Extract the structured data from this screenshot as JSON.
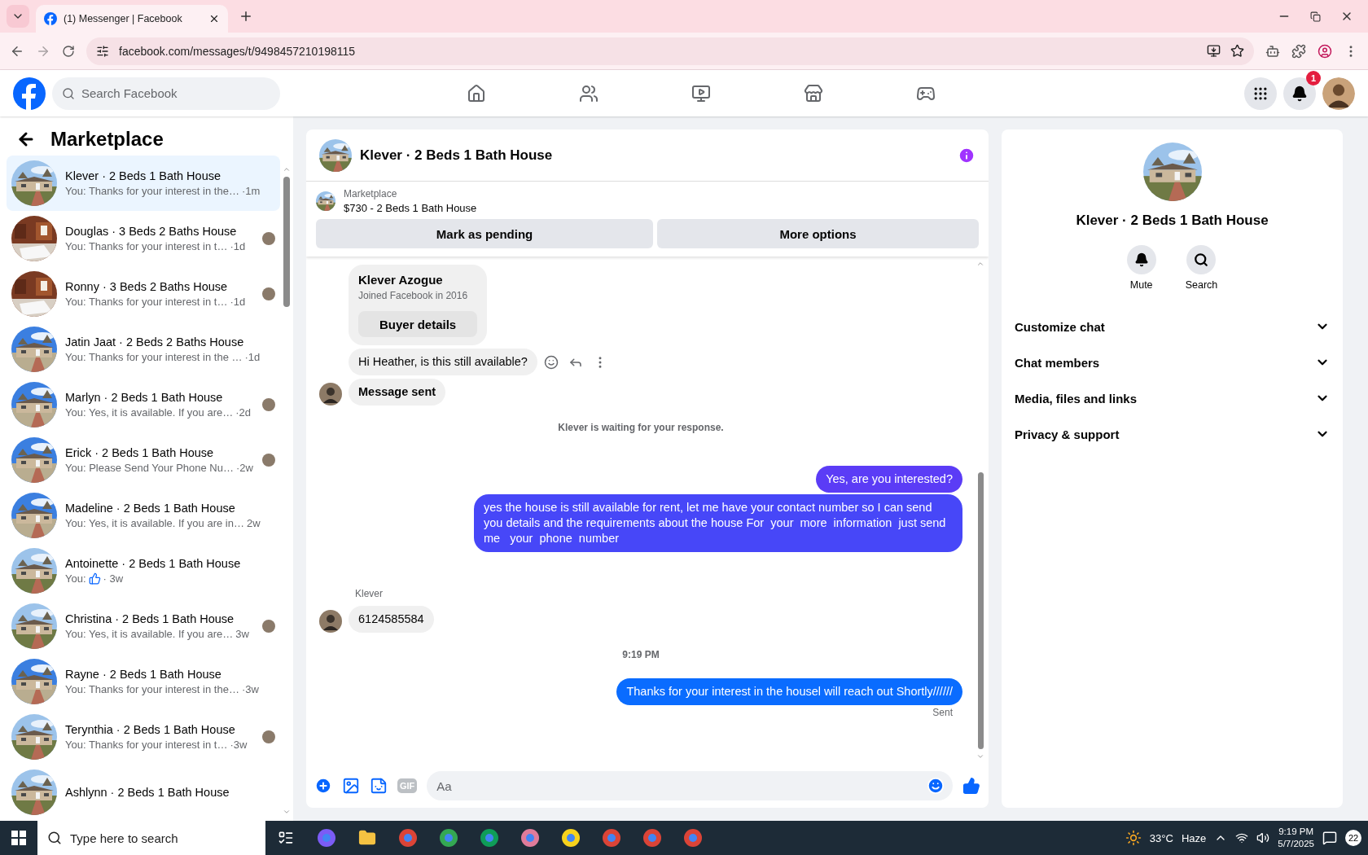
{
  "browser": {
    "tab": {
      "title": "(1) Messenger | Facebook",
      "selected": true
    },
    "url": "facebook.com/messages/t/9498457210198115"
  },
  "header": {
    "search": {
      "placeholder": "Search Facebook"
    },
    "notification_badge": "1"
  },
  "sidebar": {
    "title": "Marketplace",
    "conversations": [
      {
        "title": "Klever · 2 Beds 1 Bath House",
        "preview": "You: Thanks for your interest in the…",
        "time": "·1m",
        "selected": true,
        "seen": false,
        "kind": "text"
      },
      {
        "title": "Douglas · 3 Beds 2 Baths House",
        "preview": "You: Thanks for your interest in t…",
        "time": "·1d",
        "selected": false,
        "seen": true,
        "kind": "text"
      },
      {
        "title": "Ronny · 3 Beds 2 Baths House",
        "preview": "You: Thanks for your interest in t…",
        "time": "·1d",
        "selected": false,
        "seen": true,
        "kind": "text"
      },
      {
        "title": "Jatin Jaat · 2 Beds 2 Baths House",
        "preview": "You: Thanks for your interest in the …",
        "time": "·1d",
        "selected": false,
        "seen": false,
        "kind": "text"
      },
      {
        "title": "Marlyn · 2 Beds 1 Bath House",
        "preview": "You: Yes, it is available. If you are…",
        "time": "·2d",
        "selected": false,
        "seen": true,
        "kind": "text"
      },
      {
        "title": "Erick · 2 Beds 1 Bath House",
        "preview": "You: Please Send Your Phone Nu…",
        "time": "·2w",
        "selected": false,
        "seen": true,
        "kind": "text"
      },
      {
        "title": "Madeline · 2 Beds 1 Bath House",
        "preview": "You: Yes, it is available. If you are in…",
        "time": "2w",
        "selected": false,
        "seen": false,
        "kind": "text"
      },
      {
        "title": "Antoinette · 2 Beds 1 Bath House",
        "preview": "You:",
        "time": "· 3w",
        "selected": false,
        "seen": false,
        "kind": "like"
      },
      {
        "title": "Christina · 2 Beds 1 Bath House",
        "preview": "You: Yes, it is available. If you are…",
        "time": "3w",
        "selected": false,
        "seen": true,
        "kind": "text"
      },
      {
        "title": "Rayne · 2 Beds 1 Bath House",
        "preview": "You: Thanks for your interest in the…",
        "time": "·3w",
        "selected": false,
        "seen": false,
        "kind": "text"
      },
      {
        "title": "Terynthia · 2 Beds 1 Bath House",
        "preview": "You: Thanks for your interest in t…",
        "time": "·3w",
        "selected": false,
        "seen": true,
        "kind": "text"
      },
      {
        "title": "Ashlynn · 2 Beds 1 Bath House",
        "selected": false,
        "seen": false,
        "kind": "text"
      }
    ]
  },
  "chat": {
    "title": "Klever · 2 Beds 1 Bath House",
    "listing": {
      "label": "Marketplace",
      "title": "$730 - 2 Beds 1 Bath House"
    },
    "buttons": [
      "Mark as pending",
      "More options"
    ],
    "messages": [
      {
        "kind": "card",
        "name": "Klever Azogue",
        "detail": "Joined Facebook in 2016",
        "button": "Buyer details"
      },
      {
        "kind": "incoming",
        "text": "Hi Heather, is this still available?",
        "avatar": false,
        "bold": false,
        "actions": true
      },
      {
        "kind": "incoming",
        "text": "Message sent",
        "avatar": true,
        "bold": true,
        "actions": false
      },
      {
        "kind": "system",
        "text": "Klever is waiting for your response."
      },
      {
        "kind": "outgoing",
        "text": "Yes, are you interested?",
        "color": "#5b3cf6"
      },
      {
        "kind": "outgoing",
        "text": "yes the house is still available for rent, let me have your contact number so I can send you details and the requirements about the house For  your  more  information  just send  me   your  phone  number",
        "color": "#4747f8"
      },
      {
        "kind": "sender",
        "text": "Klever"
      },
      {
        "kind": "incoming",
        "text": "6124585584",
        "avatar": true,
        "bold": false,
        "actions": false
      },
      {
        "kind": "time",
        "text": "9:19 PM"
      },
      {
        "kind": "outgoing",
        "text": "Thanks for your interest in the housel will reach out Shortly//////",
        "color": "#0a6cff"
      },
      {
        "kind": "status",
        "text": "Sent"
      }
    ],
    "composer": {
      "placeholder": "Aa",
      "gif": "GIF"
    }
  },
  "details": {
    "title": "Klever · 2 Beds 1 Bath House",
    "actions": [
      "Mute",
      "Search"
    ],
    "sections": [
      {
        "label": "Customize chat",
        "expanded": false
      },
      {
        "label": "Chat members",
        "expanded": false
      },
      {
        "label": "Media, files and links",
        "expanded": false
      },
      {
        "label": "Privacy & support",
        "expanded": false
      }
    ]
  },
  "taskbar": {
    "search": {
      "placeholder": "Type here to search"
    },
    "temperature": "33°C",
    "weather": "Haze",
    "time": "9:19 PM",
    "date": "5/7/2025",
    "notifications": "22"
  }
}
